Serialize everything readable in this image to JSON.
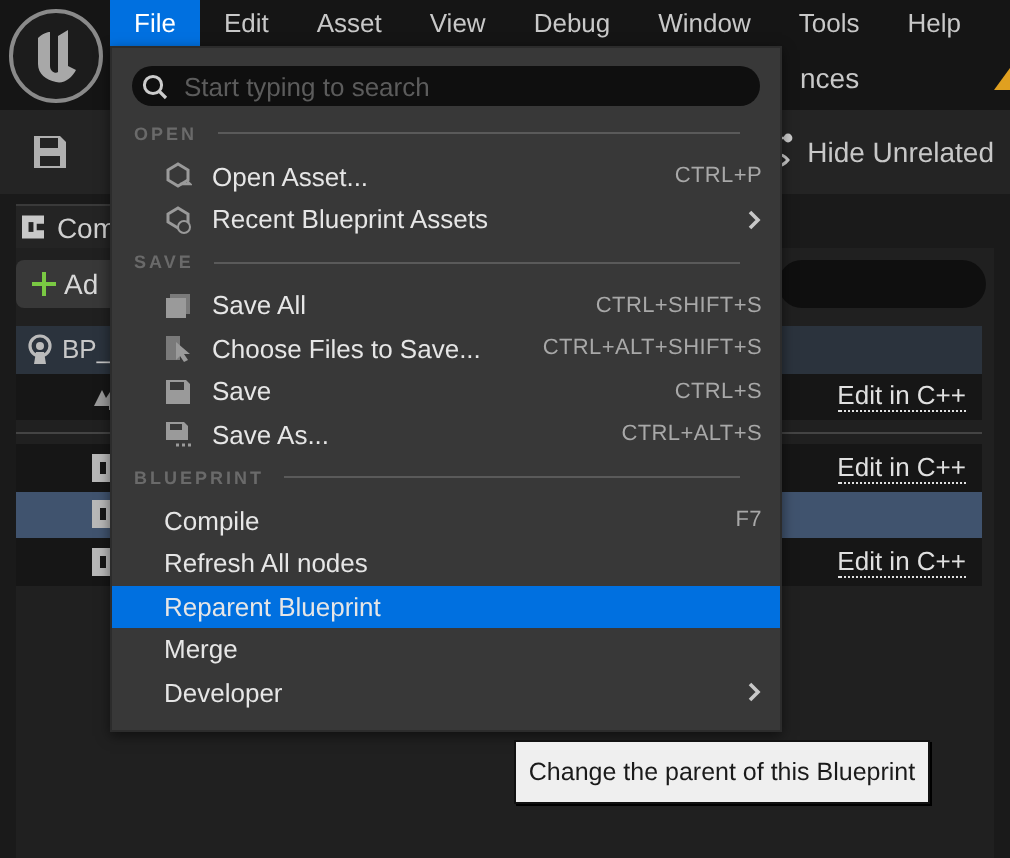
{
  "menubar": {
    "items": [
      {
        "label": "File",
        "selected": true
      },
      {
        "label": "Edit",
        "selected": false
      },
      {
        "label": "Asset",
        "selected": false
      },
      {
        "label": "View",
        "selected": false
      },
      {
        "label": "Debug",
        "selected": false
      },
      {
        "label": "Window",
        "selected": false
      },
      {
        "label": "Tools",
        "selected": false
      },
      {
        "label": "Help",
        "selected": false
      }
    ]
  },
  "editor": {
    "tab_strip_text": "nces",
    "toolbar": {
      "hide_unrelated_button": "Hide Unrelated"
    },
    "panel": {
      "tab": "Com",
      "add_button": "Ad",
      "tree": [
        {
          "kind": "root",
          "label": "BP_",
          "selected": false
        },
        {
          "kind": "component",
          "link": "Edit in C++",
          "selected": false
        },
        {
          "kind": "class",
          "link": "Edit in C++",
          "selected": false
        },
        {
          "kind": "class",
          "selected": true
        },
        {
          "kind": "class",
          "link": "Edit in C++",
          "selected": false
        }
      ]
    }
  },
  "file_menu": {
    "search": {
      "placeholder": "Start typing to search"
    },
    "sections": [
      {
        "heading": "OPEN",
        "items": [
          {
            "label": "Open Asset...",
            "shortcut": "CTRL+P",
            "selected": false
          },
          {
            "label": "Recent Blueprint Assets",
            "submenu": true,
            "selected": false
          }
        ]
      },
      {
        "heading": "SAVE",
        "items": [
          {
            "label": "Save All",
            "shortcut": "CTRL+SHIFT+S",
            "selected": false
          },
          {
            "label": "Choose Files to Save...",
            "shortcut": "CTRL+ALT+SHIFT+S",
            "selected": false
          },
          {
            "label": "Save",
            "shortcut": "CTRL+S",
            "selected": false
          },
          {
            "label": "Save As...",
            "shortcut": "CTRL+ALT+S",
            "selected": false
          }
        ]
      },
      {
        "heading": "BLUEPRINT",
        "items": [
          {
            "label": "Compile",
            "shortcut": "F7",
            "selected": false
          },
          {
            "label": "Refresh All nodes",
            "selected": false
          },
          {
            "label": "Reparent Blueprint",
            "selected": true
          },
          {
            "label": "Merge",
            "selected": false
          },
          {
            "label": "Developer",
            "submenu": true,
            "selected": false
          }
        ]
      }
    ]
  },
  "tooltip": "Change the parent of this Blueprint"
}
